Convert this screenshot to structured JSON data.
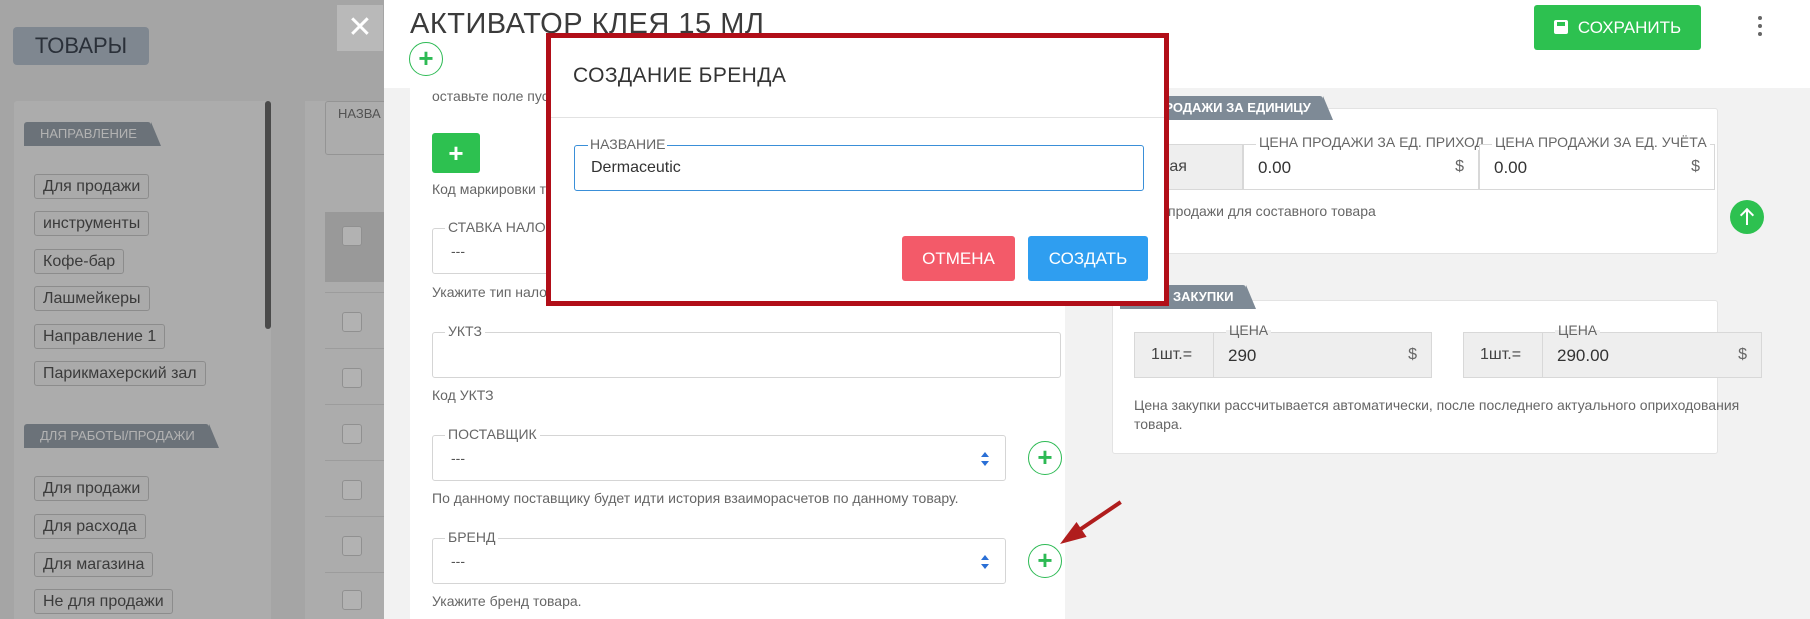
{
  "background": {
    "page_title": "ТОВАРЫ",
    "filter_label": "НАЗВА",
    "sections": [
      {
        "title": "НАПРАВЛЕНИЕ",
        "tags": [
          "Для продажи",
          "инструменты",
          "Кофе-бар",
          "Лашмейкеры",
          "Направление 1",
          "Парикмахерский зал"
        ]
      },
      {
        "title": "ДЛЯ РАБОТЫ/ПРОДАЖИ",
        "tags": [
          "Для продажи",
          "Для расхода",
          "Для магазина",
          "Не для продажи"
        ]
      }
    ]
  },
  "product": {
    "title": "АКТИВАТОР КЛЕЯ 15 МЛ",
    "save_label": "СОХРАНИТЬ",
    "hint_empty": "оставьте поле пус",
    "marking_hint": "Код маркировки т",
    "tax": {
      "label": "СТАВКА НАЛОГ",
      "value": "---",
      "hint": "Укажите тип налог"
    },
    "uktz": {
      "label": "УКТЗ",
      "hint": "Код УКТЗ"
    },
    "supplier": {
      "label": "ПОСТАВЩИК",
      "value": "---",
      "hint": "По данному поставщику будет идти история взаиморасчетов по данному товару."
    },
    "brand": {
      "label": "БРЕНД",
      "value": "---",
      "hint": "Укажите бренд товара."
    }
  },
  "sale_price": {
    "ribbon": "А ПРОДАЖИ ЗА ЕДИНИЦУ",
    "base_label": "зовая",
    "field1": {
      "label": "ЦЕНА ПРОДАЖИ ЗА ЕД. ПРИХОД",
      "value": "0.00",
      "currency": "$"
    },
    "field2": {
      "label": "ЦЕНА ПРОДАЖИ ЗА ЕД. УЧЁТА",
      "value": "0.00",
      "currency": "$"
    },
    "hint": "продажи для составного товара"
  },
  "purchase_price": {
    "ribbon": "А ЗАКУПКИ",
    "prefix": "1шт.=",
    "field1": {
      "label": "ЦЕНА",
      "value": "290",
      "currency": "$"
    },
    "field2": {
      "label": "ЦЕНА",
      "value": "290.00",
      "currency": "$"
    },
    "hint_line1": "Цена закупки рассчитывается автоматически, после последнего актуального оприходования",
    "hint_line2": "товара."
  },
  "modal": {
    "title": "СОЗДАНИЕ БРЕНДА",
    "field_label": "НАЗВАНИЕ",
    "field_value": "Dermaceutic",
    "cancel_label": "ОТМЕНА",
    "create_label": "СОЗДАТЬ"
  },
  "colors": {
    "accent_green": "#2dc150",
    "modal_border": "#b10e18",
    "create_blue": "#2f9ef0",
    "cancel_red": "#f35a69"
  }
}
